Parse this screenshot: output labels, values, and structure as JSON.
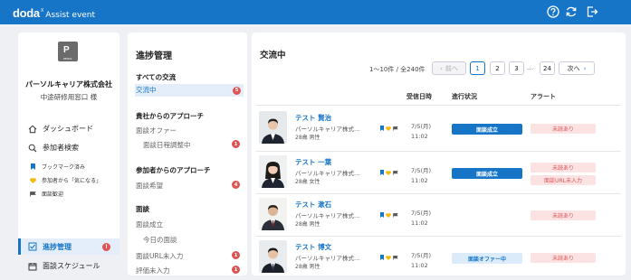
{
  "brand": {
    "logo": "doda",
    "sup": "X",
    "subtitle": "Assist event"
  },
  "header_icons": [
    "help-icon",
    "refresh-icon",
    "logout-icon"
  ],
  "company_card": {
    "logo_text": "P",
    "logo_caption": "PERSOL",
    "company_name": "パーソルキャリア株式会社",
    "contact": "中途研修用窓口 様"
  },
  "nav": {
    "dashboard": "ダッシュボード",
    "participant_search": "参加者検索",
    "sub_bookmarks": "ブックマーク済み",
    "sub_interested": "参加者から「気になる」",
    "sub_interview": "面談歓迎",
    "progress": "進捗管理",
    "progress_alert": "!",
    "schedule": "面談スケジュール"
  },
  "progress_menu": {
    "title": "進捗管理",
    "all_section": "すべての交流",
    "active": {
      "label": "交流中",
      "badge": "5"
    },
    "company_section": "貴社からのアプローチ",
    "offer": "面談オファー",
    "adjusting": {
      "label": "面談日程調整中",
      "badge": "1"
    },
    "participant_section": "参加者からのアプローチ",
    "wish": {
      "label": "面談希望",
      "badge": "4"
    },
    "interview_section": "面談",
    "established": "面談成立",
    "today": "今日の面談",
    "url_missing": {
      "label": "面談URL未入力",
      "badge": "1"
    },
    "eval_missing": {
      "label": "評価未入力",
      "badge": "1"
    }
  },
  "main": {
    "title": "交流中",
    "page_count": "1〜10件 / 全240件",
    "prev": "前へ",
    "next": "次へ",
    "pages": [
      "1",
      "2",
      "3"
    ],
    "ellipsis": "…",
    "last_page": "24",
    "headers": {
      "date": "受信日時",
      "status": "進行状況",
      "alert": "アラート"
    }
  },
  "candidates": [
    {
      "name": "テスト 賢治",
      "company": "パーソルキャリア株式…",
      "age_gender": "28歳 男性",
      "date": "7/5(月)",
      "time": "11:02",
      "status": "面談成立",
      "status_type": "done",
      "alerts": [
        "未読あり"
      ],
      "gender": "male"
    },
    {
      "name": "テスト 一葉",
      "company": "パーソルキャリア株式…",
      "age_gender": "28歳 女性",
      "date": "7/5(月)",
      "time": "11:02",
      "status": "面談成立",
      "status_type": "done",
      "alerts": [
        "未読あり",
        "面談URL未入力"
      ],
      "gender": "female"
    },
    {
      "name": "テスト 漱石",
      "company": "パーソルキャリア株式…",
      "age_gender": "28歳 男性",
      "date": "7/5(月)",
      "time": "11:02",
      "status": "",
      "status_type": "none",
      "alerts": [
        "未読あり"
      ],
      "gender": "male2"
    },
    {
      "name": "テスト 博文",
      "company": "パーソルキャリア株式…",
      "age_gender": "28歳 男性",
      "date": "7/5(月)",
      "time": "11:02",
      "status": "面談オファー中",
      "status_type": "pending",
      "alerts": [
        "未読あり"
      ],
      "gender": "male"
    }
  ],
  "colors": {
    "primary": "#1675c7",
    "alert": "#e05353",
    "background": "#eef0f4"
  }
}
